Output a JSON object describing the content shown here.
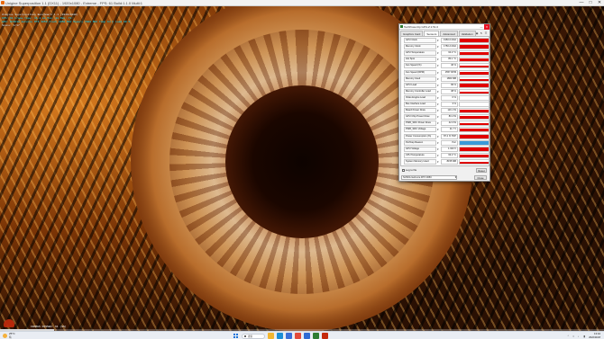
{
  "app": {
    "title": "Unigine Superposition 1.1 (DX11) - 1920x1080 - Extreme - FPS: 61 Build:1.1.0 Multi:1",
    "controls": [
      "—",
      "□",
      "✕"
    ]
  },
  "osd": [
    "Unigine Superposition Benchmark 1.1 (1920x1080)",
    "FPS: 61   Frame time: 16.4 ms   Min: 48   Max: 73",
    "GPU: NVIDIA GeForce RTX 3050   Clock 1950 MHz   Memory 7000 MHz   Temp 64 C   Load 99 %",
    "Scene: 1/17"
  ],
  "bench_status": "FRAMES PASSED: 61   (9%)",
  "bench_progress_pct": 9,
  "gpuz": {
    "title": "TechPowerUp GPU-Z 2.51.0",
    "tabs": [
      {
        "label": "Graphics Card",
        "active": false
      },
      {
        "label": "Sensors",
        "active": true
      },
      {
        "label": "Advanced",
        "active": false
      },
      {
        "label": "Validation",
        "active": false
      }
    ],
    "tool_icons": [
      "camera-icon",
      "refresh-icon",
      "menu-icon"
    ],
    "sensors": [
      {
        "name": "GPU Clock",
        "value": "1950.0 MHz",
        "level": 0.92,
        "color": "#e00000"
      },
      {
        "name": "Memory Clock",
        "value": "1750.2 MHz",
        "level": 0.92,
        "color": "#e00000"
      },
      {
        "name": "GPU Temperature",
        "value": "64.0 °C",
        "level": 0.8,
        "color": "#e00000"
      },
      {
        "name": "Hot Spot",
        "value": "80.1 °C",
        "level": 0.85,
        "color": "#e00000"
      },
      {
        "name": "Fan Speed (%)",
        "value": "46 %",
        "level": 0.55,
        "color": "#e00000"
      },
      {
        "name": "Fan Speed (RPM)",
        "value": "1557 RPM",
        "level": 0.55,
        "color": "#e00000"
      },
      {
        "name": "Memory Used",
        "value": "1863 MB",
        "level": 0.3,
        "color": "#e00000"
      },
      {
        "name": "GPU Load",
        "value": "99 %",
        "level": 0.95,
        "color": "#e00000"
      },
      {
        "name": "Memory Controller Load",
        "value": "38 %",
        "level": 0.45,
        "color": "#e00000"
      },
      {
        "name": "Video Engine Load",
        "value": "0 %",
        "level": 0.05,
        "color": "#e00000"
      },
      {
        "name": "Bus Interface Load",
        "value": "3 %",
        "level": 0.1,
        "color": "#e00000"
      },
      {
        "name": "Board Power Draw",
        "value": "116.1 W",
        "level": 0.9,
        "color": "#e00000"
      },
      {
        "name": "GPU Chip Power Draw",
        "value": "80.4 W",
        "level": 0.85,
        "color": "#e00000"
      },
      {
        "name": "PWR_SRC Power Draw",
        "value": "42.3 W",
        "level": 0.7,
        "color": "#e00000"
      },
      {
        "name": "PWR_SRC Voltage",
        "value": "11.7 V",
        "level": 0.85,
        "color": "#e00000"
      },
      {
        "name": "Power Consumption (%)",
        "value": "87.2 % TDP",
        "level": 0.9,
        "color": "#e00000"
      },
      {
        "name": "PerfCap Reason",
        "value": "Pwr",
        "level": 1.0,
        "color": "#3a9ad9"
      },
      {
        "name": "GPU Voltage",
        "value": "1.043 V",
        "level": 0.85,
        "color": "#e00000"
      },
      {
        "name": "CPU Temperature",
        "value": "63.0 °C",
        "level": 0.75,
        "color": "#e00000"
      },
      {
        "name": "System Memory Used",
        "value": "8155 MB",
        "level": 0.55,
        "color": "#e00000"
      }
    ],
    "log_label": "Log to file",
    "reset_label": "Reset",
    "gpu_select": "NVIDIA GeForce RTX 3050",
    "close_label": "Close"
  },
  "taskbar": {
    "weather_temp": "25°C",
    "weather_desc": "晴",
    "search_placeholder": "搜索",
    "apps": [
      {
        "name": "file-explorer-icon",
        "color": "#f2b632"
      },
      {
        "name": "edge-icon",
        "color": "#1b8ed6"
      },
      {
        "name": "store-icon",
        "color": "#3b6fd8"
      },
      {
        "name": "chrome-icon",
        "color": "#e24b3b"
      },
      {
        "name": "mail-icon",
        "color": "#2f6bd3"
      },
      {
        "name": "gpuz-icon",
        "color": "#2e7d32"
      },
      {
        "name": "superposition-icon",
        "color": "#c42a0c"
      }
    ],
    "tray_icons": [
      "chevron-up-icon",
      "wifi-icon",
      "speaker-icon",
      "battery-icon"
    ],
    "time": "13:42",
    "date": "2022/11/18"
  }
}
